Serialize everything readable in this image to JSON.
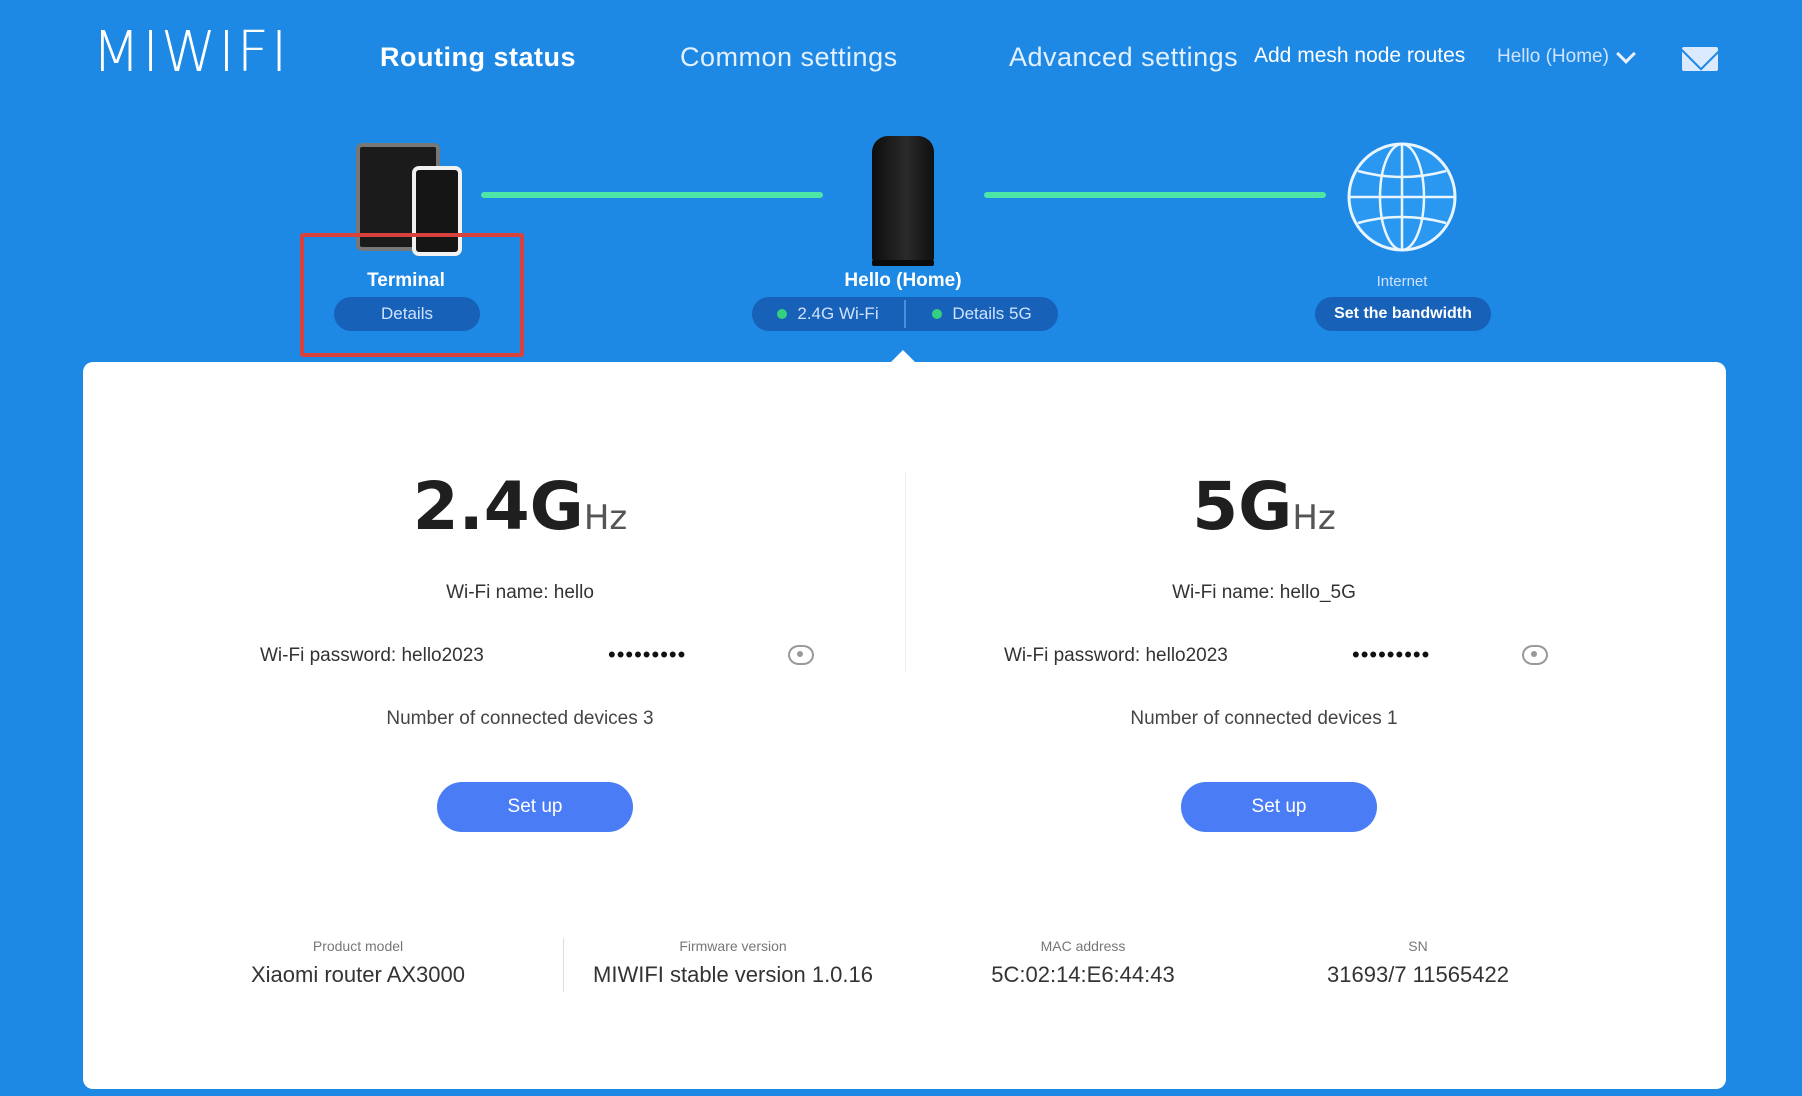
{
  "header": {
    "logo": "MIWIFI",
    "nav": {
      "routing_status": "Routing status",
      "common_settings": "Common settings",
      "advanced_settings": "Advanced settings",
      "add_mesh": "Add mesh node routes"
    },
    "user": "Hello (Home)",
    "icons": [
      "chevron-down-icon",
      "mail-icon"
    ]
  },
  "topology": {
    "terminal": {
      "label": "Terminal",
      "button": "Details"
    },
    "router": {
      "label": "Hello (Home)",
      "band_24": "2.4G Wi-Fi",
      "band_5": "Details 5G"
    },
    "internet": {
      "label": "Internet",
      "button": "Set the bandwidth"
    },
    "colors": {
      "link": "#4ee6a7",
      "highlight": "#d9413d",
      "status_dot": "#35d07f"
    }
  },
  "bands": [
    {
      "big": "2.4G",
      "unit": "Hz",
      "wifi_name": "Wi-Fi name: hello",
      "wifi_password": "Wi-Fi password: hello2023",
      "masked": "•••••••••",
      "connected": "Number of connected devices 3",
      "button": "Set up"
    },
    {
      "big": "5G",
      "unit": "Hz",
      "wifi_name": "Wi-Fi name: hello_5G",
      "wifi_password": "Wi-Fi password: hello2023",
      "masked": "•••••••••",
      "connected": "Number of connected devices 1",
      "button": "Set up"
    }
  ],
  "device_info": [
    {
      "label": "Product model",
      "value": "Xiaomi router AX3000"
    },
    {
      "label": "Firmware version",
      "value": "MIWIFI stable version 1.0.16"
    },
    {
      "label": "MAC address",
      "value": "5C:02:14:E6:44:43"
    },
    {
      "label": "SN",
      "value": "31693/7 11565422"
    }
  ],
  "accent": "#4a7cf6",
  "background": "#1E88E5"
}
